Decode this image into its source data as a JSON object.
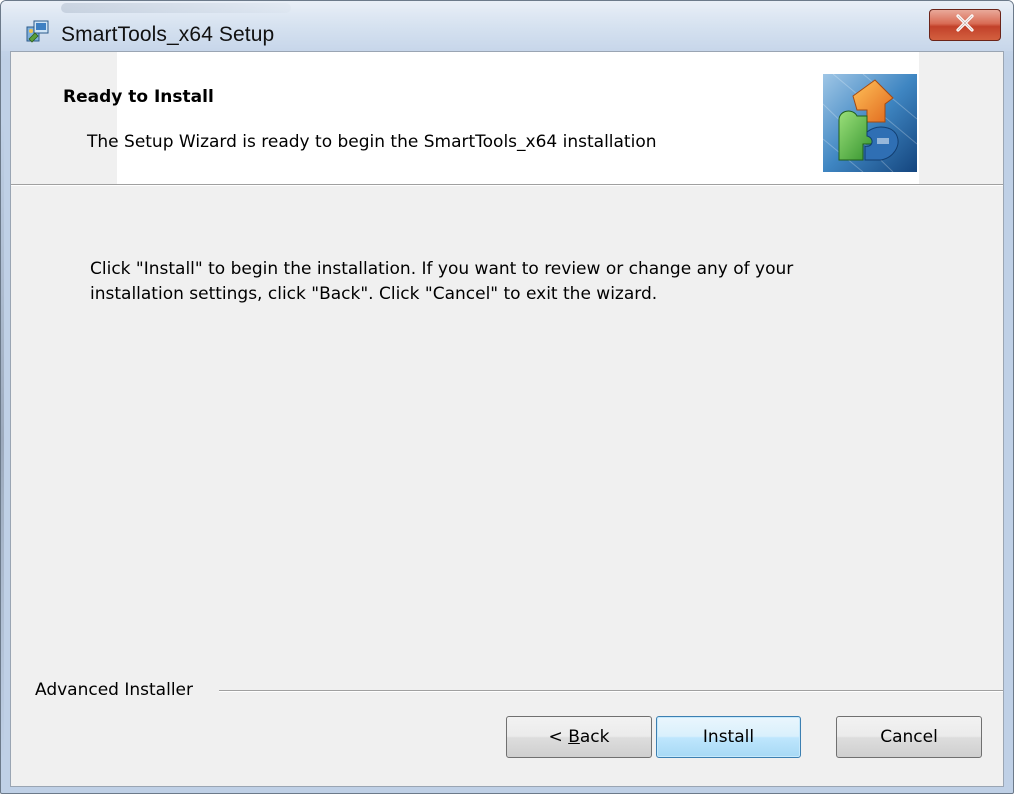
{
  "window": {
    "title": "SmartTools_x64 Setup",
    "close_glyph": "X"
  },
  "banner": {
    "title": "Ready to Install",
    "subtitle": "The Setup Wizard is ready to begin the SmartTools_x64 installation",
    "image_icon": "puzzle-arrow-icon"
  },
  "body": {
    "message": "Click \"Install\" to begin the installation.  If you want to review or change any of your\ninstallation settings, click \"Back\".  Click \"Cancel\" to exit the wizard."
  },
  "footer": {
    "brand_label": "Advanced Installer"
  },
  "buttons": {
    "back": {
      "prefix": "< ",
      "mnemonic": "B",
      "rest": "ack"
    },
    "install": "Install",
    "cancel": "Cancel"
  },
  "colors": {
    "close_button": "#c2412a",
    "default_button_border": "#3c7fb1",
    "dialog_background": "#f0f0f0"
  }
}
